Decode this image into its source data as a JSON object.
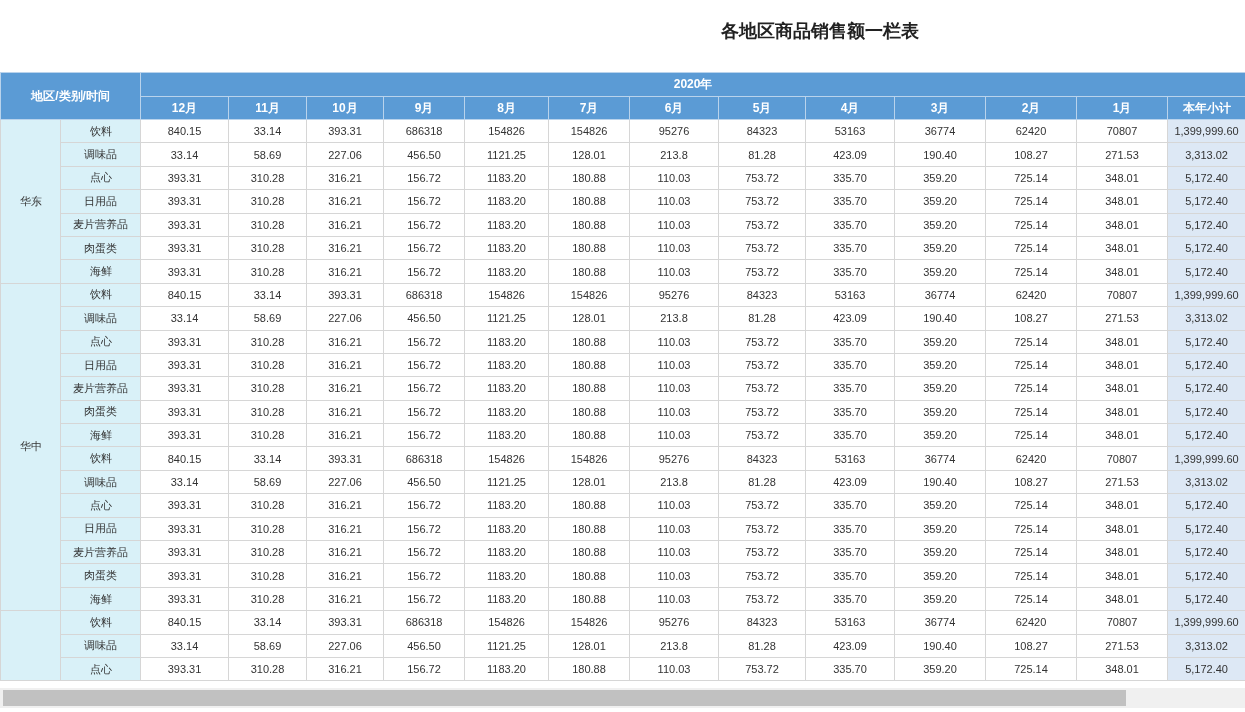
{
  "title": "各地区商品销售额一栏表",
  "corner_header": "地区/类别/时间",
  "year_header": "2020年",
  "columns": [
    {
      "label": "12月",
      "kind": "month"
    },
    {
      "label": "11月",
      "kind": "month"
    },
    {
      "label": "10月",
      "kind": "month"
    },
    {
      "label": "9月",
      "kind": "month"
    },
    {
      "label": "8月",
      "kind": "month"
    },
    {
      "label": "7月",
      "kind": "month"
    },
    {
      "label": "6月",
      "kind": "month"
    },
    {
      "label": "5月",
      "kind": "month"
    },
    {
      "label": "4月",
      "kind": "month"
    },
    {
      "label": "3月",
      "kind": "month"
    },
    {
      "label": "2月",
      "kind": "month"
    },
    {
      "label": "1月",
      "kind": "month"
    },
    {
      "label": "本年小计",
      "kind": "subtotal"
    }
  ],
  "groups": [
    {
      "region": "华东",
      "rows": [
        {
          "category": "饮料",
          "values": [
            "840.15",
            "33.14",
            "393.31",
            "686318",
            "154826",
            "154826",
            "95276",
            "84323",
            "53163",
            "36774",
            "62420",
            "70807",
            "1,399,999.60"
          ]
        },
        {
          "category": "调味品",
          "values": [
            "33.14",
            "58.69",
            "227.06",
            "456.50",
            "1121.25",
            "128.01",
            "213.8",
            "81.28",
            "423.09",
            "190.40",
            "108.27",
            "271.53",
            "3,313.02"
          ]
        },
        {
          "category": "点心",
          "values": [
            "393.31",
            "310.28",
            "316.21",
            "156.72",
            "1183.20",
            "180.88",
            "110.03",
            "753.72",
            "335.70",
            "359.20",
            "725.14",
            "348.01",
            "5,172.40"
          ]
        },
        {
          "category": "日用品",
          "values": [
            "393.31",
            "310.28",
            "316.21",
            "156.72",
            "1183.20",
            "180.88",
            "110.03",
            "753.72",
            "335.70",
            "359.20",
            "725.14",
            "348.01",
            "5,172.40"
          ]
        },
        {
          "category": "麦片营养品",
          "values": [
            "393.31",
            "310.28",
            "316.21",
            "156.72",
            "1183.20",
            "180.88",
            "110.03",
            "753.72",
            "335.70",
            "359.20",
            "725.14",
            "348.01",
            "5,172.40"
          ]
        },
        {
          "category": "肉蛋类",
          "values": [
            "393.31",
            "310.28",
            "316.21",
            "156.72",
            "1183.20",
            "180.88",
            "110.03",
            "753.72",
            "335.70",
            "359.20",
            "725.14",
            "348.01",
            "5,172.40"
          ]
        },
        {
          "category": "海鲜",
          "values": [
            "393.31",
            "310.28",
            "316.21",
            "156.72",
            "1183.20",
            "180.88",
            "110.03",
            "753.72",
            "335.70",
            "359.20",
            "725.14",
            "348.01",
            "5,172.40"
          ]
        }
      ]
    },
    {
      "region": "华中",
      "rows": [
        {
          "category": "饮料",
          "values": [
            "840.15",
            "33.14",
            "393.31",
            "686318",
            "154826",
            "154826",
            "95276",
            "84323",
            "53163",
            "36774",
            "62420",
            "70807",
            "1,399,999.60"
          ]
        },
        {
          "category": "调味品",
          "values": [
            "33.14",
            "58.69",
            "227.06",
            "456.50",
            "1121.25",
            "128.01",
            "213.8",
            "81.28",
            "423.09",
            "190.40",
            "108.27",
            "271.53",
            "3,313.02"
          ]
        },
        {
          "category": "点心",
          "values": [
            "393.31",
            "310.28",
            "316.21",
            "156.72",
            "1183.20",
            "180.88",
            "110.03",
            "753.72",
            "335.70",
            "359.20",
            "725.14",
            "348.01",
            "5,172.40"
          ]
        },
        {
          "category": "日用品",
          "values": [
            "393.31",
            "310.28",
            "316.21",
            "156.72",
            "1183.20",
            "180.88",
            "110.03",
            "753.72",
            "335.70",
            "359.20",
            "725.14",
            "348.01",
            "5,172.40"
          ]
        },
        {
          "category": "麦片营养品",
          "values": [
            "393.31",
            "310.28",
            "316.21",
            "156.72",
            "1183.20",
            "180.88",
            "110.03",
            "753.72",
            "335.70",
            "359.20",
            "725.14",
            "348.01",
            "5,172.40"
          ]
        },
        {
          "category": "肉蛋类",
          "values": [
            "393.31",
            "310.28",
            "316.21",
            "156.72",
            "1183.20",
            "180.88",
            "110.03",
            "753.72",
            "335.70",
            "359.20",
            "725.14",
            "348.01",
            "5,172.40"
          ]
        },
        {
          "category": "海鲜",
          "values": [
            "393.31",
            "310.28",
            "316.21",
            "156.72",
            "1183.20",
            "180.88",
            "110.03",
            "753.72",
            "335.70",
            "359.20",
            "725.14",
            "348.01",
            "5,172.40"
          ]
        },
        {
          "category": "饮料",
          "values": [
            "840.15",
            "33.14",
            "393.31",
            "686318",
            "154826",
            "154826",
            "95276",
            "84323",
            "53163",
            "36774",
            "62420",
            "70807",
            "1,399,999.60"
          ]
        },
        {
          "category": "调味品",
          "values": [
            "33.14",
            "58.69",
            "227.06",
            "456.50",
            "1121.25",
            "128.01",
            "213.8",
            "81.28",
            "423.09",
            "190.40",
            "108.27",
            "271.53",
            "3,313.02"
          ]
        },
        {
          "category": "点心",
          "values": [
            "393.31",
            "310.28",
            "316.21",
            "156.72",
            "1183.20",
            "180.88",
            "110.03",
            "753.72",
            "335.70",
            "359.20",
            "725.14",
            "348.01",
            "5,172.40"
          ]
        },
        {
          "category": "日用品",
          "values": [
            "393.31",
            "310.28",
            "316.21",
            "156.72",
            "1183.20",
            "180.88",
            "110.03",
            "753.72",
            "335.70",
            "359.20",
            "725.14",
            "348.01",
            "5,172.40"
          ]
        },
        {
          "category": "麦片营养品",
          "values": [
            "393.31",
            "310.28",
            "316.21",
            "156.72",
            "1183.20",
            "180.88",
            "110.03",
            "753.72",
            "335.70",
            "359.20",
            "725.14",
            "348.01",
            "5,172.40"
          ]
        },
        {
          "category": "肉蛋类",
          "values": [
            "393.31",
            "310.28",
            "316.21",
            "156.72",
            "1183.20",
            "180.88",
            "110.03",
            "753.72",
            "335.70",
            "359.20",
            "725.14",
            "348.01",
            "5,172.40"
          ]
        },
        {
          "category": "海鲜",
          "values": [
            "393.31",
            "310.28",
            "316.21",
            "156.72",
            "1183.20",
            "180.88",
            "110.03",
            "753.72",
            "335.70",
            "359.20",
            "725.14",
            "348.01",
            "5,172.40"
          ]
        }
      ]
    },
    {
      "rows": [
        {
          "category": "饮料",
          "values": [
            "840.15",
            "33.14",
            "393.31",
            "686318",
            "154826",
            "154826",
            "95276",
            "84323",
            "53163",
            "36774",
            "62420",
            "70807",
            "1,399,999.60"
          ]
        },
        {
          "category": "调味品",
          "values": [
            "33.14",
            "58.69",
            "227.06",
            "456.50",
            "1121.25",
            "128.01",
            "213.8",
            "81.28",
            "423.09",
            "190.40",
            "108.27",
            "271.53",
            "3,313.02"
          ]
        },
        {
          "category": "点心",
          "values": [
            "393.31",
            "310.28",
            "316.21",
            "156.72",
            "1183.20",
            "180.88",
            "110.03",
            "753.72",
            "335.70",
            "359.20",
            "725.14",
            "348.01",
            "5,172.40"
          ]
        }
      ]
    }
  ]
}
